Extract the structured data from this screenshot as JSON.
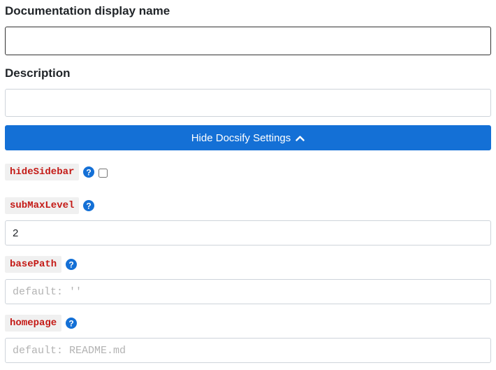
{
  "doc_name": {
    "label": "Documentation display name",
    "value": ""
  },
  "description": {
    "label": "Description",
    "value": ""
  },
  "docsify_toggle": {
    "label": "Hide Docsify Settings",
    "icon": "chevron-up-icon",
    "color": "#1470d6"
  },
  "settings": {
    "hide_sidebar": {
      "label": "hideSidebar",
      "checked": false
    },
    "sub_max_level": {
      "label": "subMaxLevel",
      "value": "2"
    },
    "base_path": {
      "label": "basePath",
      "placeholder": "default: ''",
      "value": ""
    },
    "homepage": {
      "label": "homepage",
      "placeholder": "default: README.md",
      "value": ""
    }
  },
  "colors": {
    "code_text": "#c41a16",
    "code_bg": "#f0f0f0",
    "help_icon": "#1470d6"
  }
}
